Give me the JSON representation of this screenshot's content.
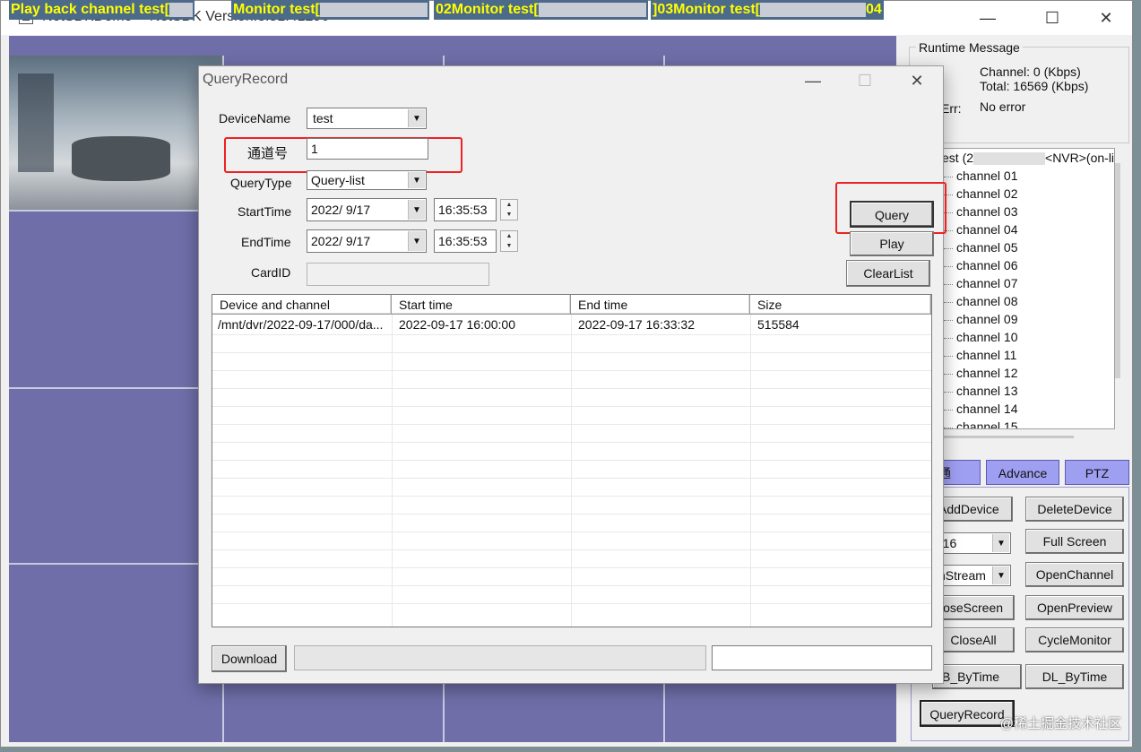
{
  "main_window": {
    "title": "NetSDKDemo  --NetSDK Version:3.51.41296",
    "min_glyph": "—",
    "max_glyph": "☐",
    "close_glyph": "✕"
  },
  "video": {
    "monitor_labels": [
      "Play back channel test[",
      "Monitor test[",
      "02Monitor test[",
      "]03Monitor test[",
      "04"
    ]
  },
  "runtime": {
    "group_label": "Runtime Message",
    "channel_text": "Channel: 0 (Kbps)",
    "total_text": "Total: 16569 (Kbps)",
    "err_label": "Err:",
    "err_value": "No error"
  },
  "device_tree": {
    "root_label_left": "est (2",
    "root_label_right": "<NVR>(on-li",
    "channels": [
      "channel 01",
      "channel 02",
      "channel 03",
      "channel 04",
      "channel 05",
      "channel 06",
      "channel 07",
      "channel 08",
      "channel 09",
      "channel 10",
      "channel 11",
      "channel 12",
      "channel 13",
      "channel 14",
      "channel 15"
    ]
  },
  "tabs": {
    "first": "通",
    "advance": "Advance",
    "ptz": "PTZ"
  },
  "right_buttons": {
    "add_device": "AddDevice",
    "delete_device": "DeleteDevice",
    "split_combo": "-16",
    "full_screen": "Full Screen",
    "stream_combo": "nStream",
    "open_channel": "OpenChannel",
    "close_screen": "loseScreen",
    "open_preview": "OpenPreview",
    "close_all": "CloseAll",
    "cycle_monitor": "CycleMonitor",
    "pb_by_time": "B_ByTime",
    "dl_by_time": "DL_ByTime",
    "query_record": "QueryRecord"
  },
  "dialog": {
    "title": "QueryRecord",
    "device_name_label": "DeviceName",
    "device_name_value": "test",
    "channel_label": "通道号",
    "channel_value": "1",
    "query_type_label": "QueryType",
    "query_type_value": "Query-list",
    "start_time_label": "StartTime",
    "start_date": "2022/  9/17",
    "start_time": "16:35:53",
    "end_time_label": "EndTime",
    "end_date": "2022/  9/17",
    "end_time": "16:35:53",
    "card_id_label": "CardID",
    "card_id_value": "",
    "query_button": "Query",
    "play_button": "Play",
    "clear_list_button": "ClearList",
    "download_button": "Download",
    "columns": [
      "Device and channel",
      "Start time",
      "End time",
      "Size"
    ],
    "rows": [
      [
        "/mnt/dvr/2022-09-17/000/da...",
        "2022-09-17 16:00:00",
        "2022-09-17 16:33:32",
        "515584"
      ]
    ]
  },
  "watermark": "@稀土掘金技术社区",
  "colors": {
    "video_bg": "#6f6ea8",
    "tab_bg": "#9f9ff2",
    "highlight_red": "#e22222",
    "label_yellow": "#ffff00"
  }
}
